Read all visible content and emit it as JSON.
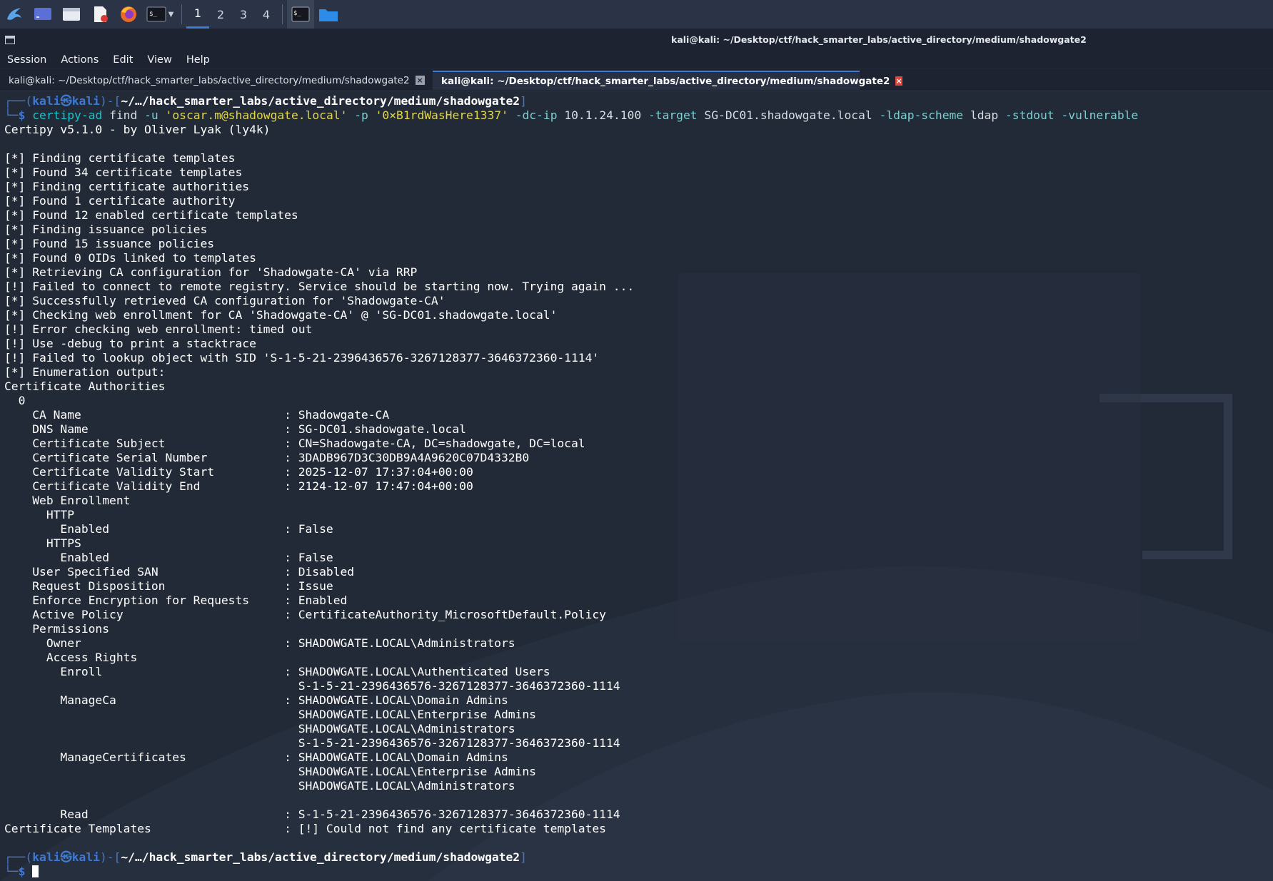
{
  "taskbar": {
    "workspaces": [
      "1",
      "2",
      "3",
      "4"
    ],
    "active_workspace": "1",
    "icons": [
      "kali-dragon-icon",
      "desktop-icon",
      "file-manager-icon",
      "text-editor-icon",
      "firefox-icon",
      "terminal-icon",
      "terminal-window-icon",
      "folder-icon"
    ]
  },
  "window": {
    "title": "kali@kali: ~/Desktop/ctf/hack_smarter_labs/active_directory/medium/shadowgate2"
  },
  "menu": [
    "Session",
    "Actions",
    "Edit",
    "View",
    "Help"
  ],
  "tabs": [
    {
      "label": "kali@kali: ~/Desktop/ctf/hack_smarter_labs/active_directory/medium/shadowgate2",
      "close": "×"
    },
    {
      "label": "kali@kali: ~/Desktop/ctf/hack_smarter_labs/active_directory/medium/shadowgate2",
      "close": "×"
    }
  ],
  "prompt": {
    "user": "kali",
    "at": "㉿",
    "host": "kali",
    "path": "~/…/hack_smarter_labs/active_directory/medium/shadowgate2",
    "symbol": "$"
  },
  "command": {
    "program": "certipy-ad",
    "sub": "find",
    "u_flag": "-u",
    "u_val": "'oscar.m@shadowgate.local'",
    "p_flag": "-p",
    "p_val": "'0×B1rdWasHere1337'",
    "dcip_flag": "-dc-ip",
    "dcip_val": "10.1.24.100",
    "target_flag": "-target",
    "target_val": "SG-DC01.shadowgate.local",
    "ldap_flag": "-ldap-scheme",
    "ldap_val": "ldap",
    "stdout_flag": "-stdout",
    "vuln_flag": "-vulnerable"
  },
  "output": [
    "Certipy v5.1.0 - by Oliver Lyak (ly4k)",
    "",
    "[*] Finding certificate templates",
    "[*] Found 34 certificate templates",
    "[*] Finding certificate authorities",
    "[*] Found 1 certificate authority",
    "[*] Found 12 enabled certificate templates",
    "[*] Finding issuance policies",
    "[*] Found 15 issuance policies",
    "[*] Found 0 OIDs linked to templates",
    "[*] Retrieving CA configuration for 'Shadowgate-CA' via RRP",
    "[!] Failed to connect to remote registry. Service should be starting now. Trying again ...",
    "[*] Successfully retrieved CA configuration for 'Shadowgate-CA'",
    "[*] Checking web enrollment for CA 'Shadowgate-CA' @ 'SG-DC01.shadowgate.local'",
    "[!] Error checking web enrollment: timed out",
    "[!] Use -debug to print a stacktrace",
    "[!] Failed to lookup object with SID 'S-1-5-21-2396436576-3267128377-3646372360-1114'",
    "[*] Enumeration output:",
    "Certificate Authorities",
    "  0",
    "    CA Name                             : Shadowgate-CA",
    "    DNS Name                            : SG-DC01.shadowgate.local",
    "    Certificate Subject                 : CN=Shadowgate-CA, DC=shadowgate, DC=local",
    "    Certificate Serial Number           : 3DADB967D3C30DB9A4A9620C07D4332B0",
    "    Certificate Validity Start          : 2025-12-07 17:37:04+00:00",
    "    Certificate Validity End            : 2124-12-07 17:47:04+00:00",
    "    Web Enrollment",
    "      HTTP",
    "        Enabled                         : False",
    "      HTTPS",
    "        Enabled                         : False",
    "    User Specified SAN                  : Disabled",
    "    Request Disposition                 : Issue",
    "    Enforce Encryption for Requests     : Enabled",
    "    Active Policy                       : CertificateAuthority_MicrosoftDefault.Policy",
    "    Permissions",
    "      Owner                             : SHADOWGATE.LOCAL\\Administrators",
    "      Access Rights",
    "        Enroll                          : SHADOWGATE.LOCAL\\Authenticated Users",
    "                                          S-1-5-21-2396436576-3267128377-3646372360-1114",
    "        ManageCa                        : SHADOWGATE.LOCAL\\Domain Admins",
    "                                          SHADOWGATE.LOCAL\\Enterprise Admins",
    "                                          SHADOWGATE.LOCAL\\Administrators",
    "                                          S-1-5-21-2396436576-3267128377-3646372360-1114",
    "        ManageCertificates              : SHADOWGATE.LOCAL\\Domain Admins",
    "                                          SHADOWGATE.LOCAL\\Enterprise Admins",
    "                                          SHADOWGATE.LOCAL\\Administrators",
    "",
    "        Read                            : S-1-5-21-2396436576-3267128377-3646372360-1114",
    "Certificate Templates                   : [!] Could not find any certificate templates",
    ""
  ],
  "colors": {
    "terminal_bg": "#222a38",
    "prompt_blue": "#3e79d4",
    "command_cyan": "#1fc3c7",
    "string_yellow": "#e1d64a",
    "accent_blue": "#3b7bd8",
    "close_red": "#e0453b"
  }
}
